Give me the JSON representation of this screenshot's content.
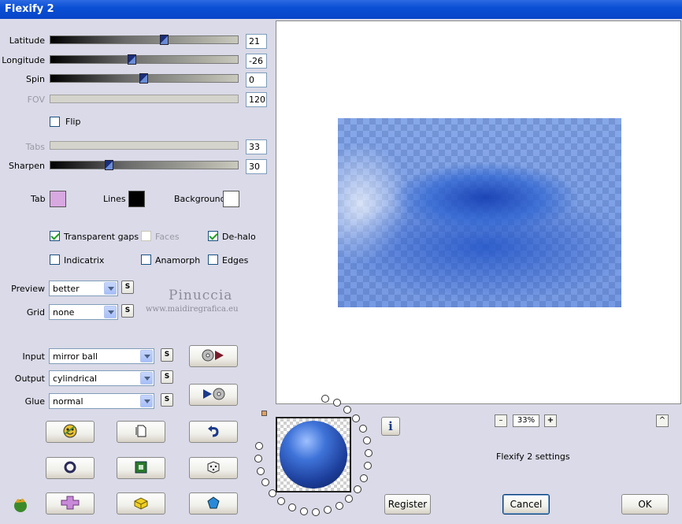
{
  "window": {
    "title": "Flexify 2"
  },
  "sliders": [
    {
      "label": "Latitude",
      "value": "21",
      "level": 0.6,
      "enabled": true
    },
    {
      "label": "Longitude",
      "value": "-26",
      "level": 0.43,
      "enabled": true
    },
    {
      "label": "Spin",
      "value": "0",
      "level": 0.5,
      "enabled": true
    },
    {
      "label": "FOV",
      "value": "120",
      "level": null,
      "enabled": false
    },
    {
      "label": "Tabs",
      "value": "33",
      "level": null,
      "enabled": false
    },
    {
      "label": "Sharpen",
      "value": "30",
      "level": 0.3,
      "enabled": true
    }
  ],
  "flip": {
    "label": "Flip",
    "checked": false
  },
  "colors": {
    "tab": {
      "label": "Tab",
      "value": "#d8a8e0"
    },
    "lines": {
      "label": "Lines",
      "value": "#000000"
    },
    "background": {
      "label": "Background",
      "value": "#ffffff"
    }
  },
  "options": {
    "transparent_gaps": {
      "label": "Transparent gaps",
      "checked": true
    },
    "faces": {
      "label": "Faces",
      "checked": false,
      "enabled": false
    },
    "de_halo": {
      "label": "De-halo",
      "checked": true
    },
    "indicatrix": {
      "label": "Indicatrix",
      "checked": false
    },
    "anamorph": {
      "label": "Anamorph",
      "checked": false
    },
    "edges": {
      "label": "Edges",
      "checked": false
    }
  },
  "preview_quality": {
    "label": "Preview",
    "value": "better",
    "s": "S"
  },
  "grid": {
    "label": "Grid",
    "value": "none",
    "s": "S"
  },
  "watermark": {
    "name": "Pinuccia",
    "url": "www.maidiregrafica.eu"
  },
  "projection": {
    "input": {
      "label": "Input",
      "value": "mirror ball",
      "s": "S"
    },
    "output": {
      "label": "Output",
      "value": "cylindrical",
      "s": "S"
    },
    "glue": {
      "label": "Glue",
      "value": "normal",
      "s": "S"
    }
  },
  "zoom": {
    "minus": "–",
    "value": "33%",
    "plus": "+"
  },
  "collapse_button": "^",
  "info_icon": "i",
  "settings_label": "Flexify 2 settings",
  "buttons": {
    "register": "Register",
    "cancel": "Cancel",
    "ok": "OK"
  },
  "icons": [
    "play-forward-icon",
    "play-reverse-icon",
    "smiley-face-icon",
    "new-page-icon",
    "undo-icon",
    "ring-icon",
    "green-square-icon",
    "dice-icon",
    "flame-logo-icon",
    "cross-shape-icon",
    "yellow-block-icon",
    "pentagon-icon"
  ],
  "accent_colors": {
    "title_bar": "#0a4fd4",
    "panel": "#dadae8",
    "slider_thumb": "#1a2d7a"
  }
}
